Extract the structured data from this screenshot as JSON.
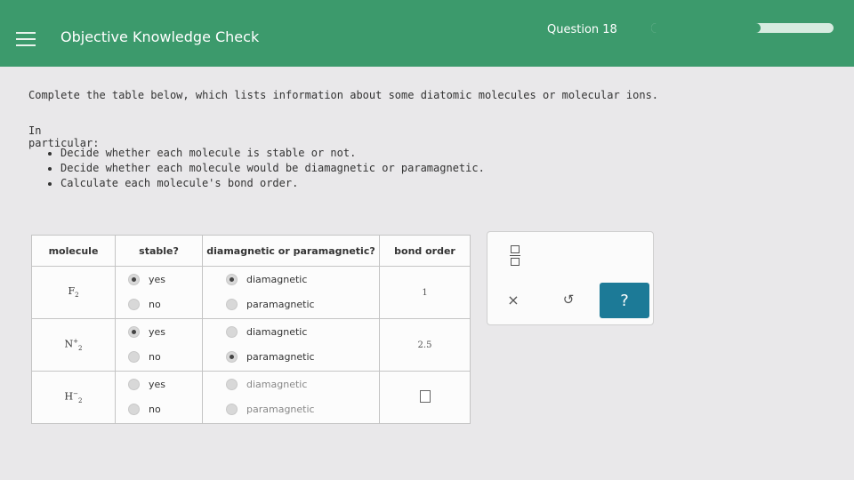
{
  "header": {
    "title": "Objective Knowledge Check",
    "question_label": "Question 18",
    "progress_fraction": 0.6
  },
  "content": {
    "intro": "Complete the table below, which lists information about some diatomic molecules or molecular ions.",
    "particular_label": "In particular:",
    "bullets": [
      "Decide whether each molecule is stable or not.",
      "Decide whether each molecule would be diamagnetic or paramagnetic.",
      "Calculate each molecule's bond order."
    ]
  },
  "table": {
    "headers": [
      "molecule",
      "stable?",
      "diamagnetic or paramagnetic?",
      "bond order"
    ],
    "option_labels": {
      "yes": "yes",
      "no": "no",
      "dia": "diamagnetic",
      "para": "paramagnetic"
    },
    "rows": [
      {
        "molecule": "F",
        "subscript": "2",
        "superscript": "",
        "stable": "yes",
        "magnetism": "diamagnetic",
        "bond_order": "1"
      },
      {
        "molecule": "N",
        "subscript": "2",
        "superscript": "+",
        "stable": "yes",
        "magnetism": "paramagnetic",
        "bond_order": "2.5"
      },
      {
        "molecule": "H",
        "subscript": "2",
        "superscript": "−",
        "stable": "",
        "magnetism": "",
        "bond_order": ""
      }
    ]
  },
  "toolbox": {
    "close_icon": "×",
    "undo_icon": "↺",
    "help_icon": "?"
  },
  "colors": {
    "header_green": "#3c9a6c",
    "help_button": "#1c7a97"
  }
}
